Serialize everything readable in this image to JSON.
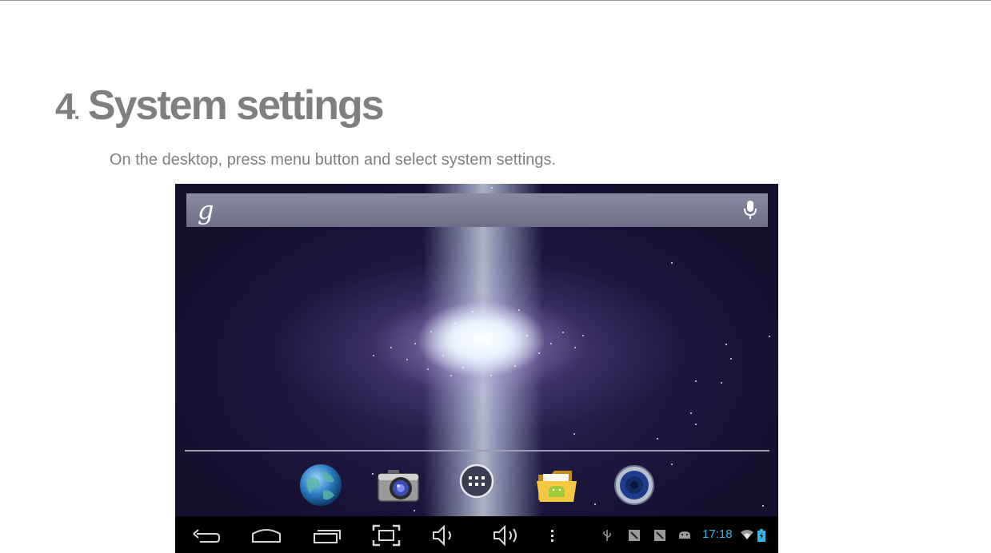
{
  "heading": {
    "number": "4",
    "dot": ".",
    "title": "System settings"
  },
  "instruction": "On the desktop, press menu button and select system settings.",
  "screenshot": {
    "search": {
      "logo": "g",
      "voice_icon": "mic-icon"
    },
    "dock": {
      "apps": [
        {
          "icon": "browser-globe-icon"
        },
        {
          "icon": "camera-icon"
        },
        {
          "icon": "all-apps-icon"
        },
        {
          "icon": "file-manager-icon"
        },
        {
          "icon": "music-speaker-icon"
        }
      ]
    },
    "navigation": [
      "back-icon",
      "home-icon",
      "recent-apps-icon",
      "screenshot-icon",
      "volume-down-icon",
      "volume-up-icon",
      "menu-icon"
    ],
    "status": {
      "icons": [
        "usb-icon",
        "notification-icon",
        "notification-icon",
        "android-debug-icon",
        "wifi-icon",
        "battery-icon"
      ],
      "time": "17:18"
    },
    "colors": {
      "clock": "#33b5e5",
      "navbar": "#000000",
      "wallpaper": "#1e1840"
    }
  }
}
